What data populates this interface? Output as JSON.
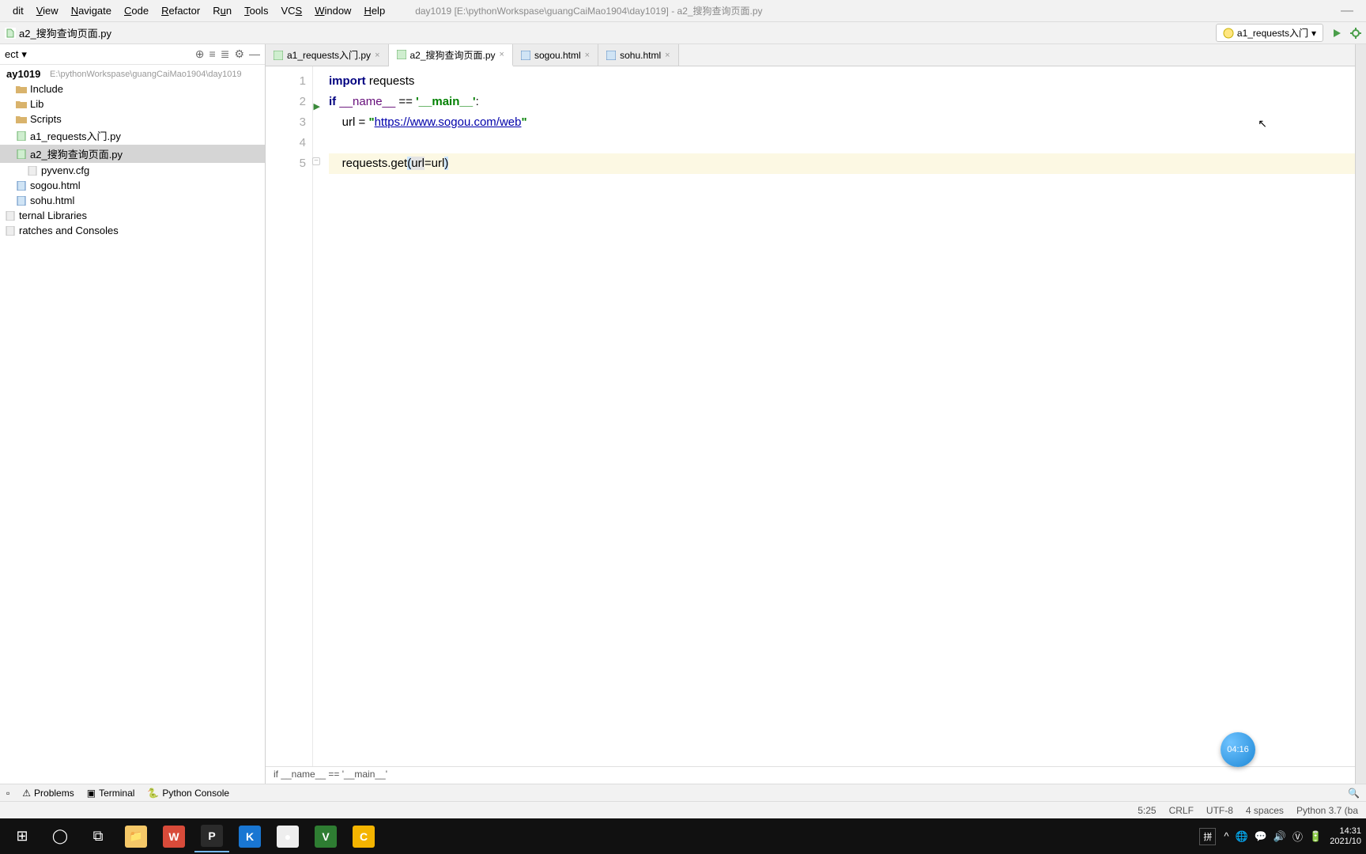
{
  "menu": {
    "items": [
      "dit",
      "View",
      "Navigate",
      "Code",
      "Refactor",
      "Run",
      "Tools",
      "VCS",
      "Window",
      "Help"
    ],
    "underline_pos": [
      0,
      0,
      0,
      0,
      0,
      0,
      0,
      2,
      0,
      0
    ],
    "title": "day1019 [E:\\pythonWorkspase\\guangCaiMao1904\\day1019] - a2_搜狗查询页面.py"
  },
  "breadcrumb": {
    "file": "a2_搜狗查询页面.py"
  },
  "run_config": {
    "label": "a1_requests入门"
  },
  "project": {
    "header": "ect",
    "root_name": "ay1019",
    "root_path": "E:\\pythonWorkspase\\guangCaiMao1904\\day1019",
    "items": [
      {
        "label": "Include",
        "type": "folder",
        "indent": 1
      },
      {
        "label": "Lib",
        "type": "folder",
        "indent": 1
      },
      {
        "label": "Scripts",
        "type": "folder",
        "indent": 1
      },
      {
        "label": "a1_requests入门.py",
        "type": "py",
        "indent": 1
      },
      {
        "label": "a2_搜狗查询页面.py",
        "type": "py",
        "indent": 1,
        "selected": true
      },
      {
        "label": "pyvenv.cfg",
        "type": "file",
        "indent": 2
      },
      {
        "label": "sogou.html",
        "type": "html",
        "indent": 1
      },
      {
        "label": "sohu.html",
        "type": "html",
        "indent": 1
      },
      {
        "label": "ternal Libraries",
        "type": "lib",
        "indent": 0
      },
      {
        "label": "ratches and Consoles",
        "type": "scratch",
        "indent": 0
      }
    ]
  },
  "tabs": [
    {
      "label": "a1_requests入门.py",
      "type": "py"
    },
    {
      "label": "a2_搜狗查询页面.py",
      "type": "py",
      "active": true
    },
    {
      "label": "sogou.html",
      "type": "html"
    },
    {
      "label": "sohu.html",
      "type": "html"
    }
  ],
  "code": {
    "lines": [
      {
        "n": 1,
        "segments": [
          {
            "t": "import ",
            "c": "kw"
          },
          {
            "t": "requests"
          }
        ]
      },
      {
        "n": 2,
        "run": true,
        "segments": [
          {
            "t": "if ",
            "c": "kw"
          },
          {
            "t": "__name__",
            "c": "mn"
          },
          {
            "t": " == "
          },
          {
            "t": "'__main__'",
            "c": "str"
          },
          {
            "t": ":"
          }
        ]
      },
      {
        "n": 3,
        "segments": [
          {
            "t": "    url = "
          },
          {
            "t": "\"",
            "c": "str"
          },
          {
            "t": "https://www.sogou.com/web",
            "c": "link"
          },
          {
            "t": "\"",
            "c": "str"
          }
        ]
      },
      {
        "n": 4,
        "segments": [
          {
            "t": " "
          }
        ]
      },
      {
        "n": 5,
        "hl": true,
        "fold": true,
        "segments": [
          {
            "t": "    requests.get"
          },
          {
            "t": "(",
            "c": "sel-paren"
          },
          {
            "t": "url",
            "c": "sel-arg"
          },
          {
            "t": "=url"
          },
          {
            "t": ")",
            "c": "sel-paren"
          }
        ]
      }
    ]
  },
  "breadcrumb_bottom": "if __name__ == '__main__'",
  "bottom_tools": {
    "items": [
      "Problems",
      "Terminal",
      "Python Console"
    ],
    "icons": [
      "⚠",
      "▣",
      "🐍"
    ]
  },
  "status": {
    "pos": "5:25",
    "eol": "CRLF",
    "enc": "UTF-8",
    "indent": "4 spaces",
    "python": "Python 3.7 (ba"
  },
  "taskbar": {
    "left_icons": [
      "⊞",
      "◯",
      "⧉",
      "📁",
      "W",
      "P",
      "K",
      "●",
      "V",
      "C"
    ],
    "ime": "拼",
    "tray": [
      "^",
      "🌐",
      "💬",
      "🔊",
      "Ⓥ",
      "🔋"
    ],
    "time": "14:31",
    "date": "2021/10"
  },
  "timer": "04:16"
}
